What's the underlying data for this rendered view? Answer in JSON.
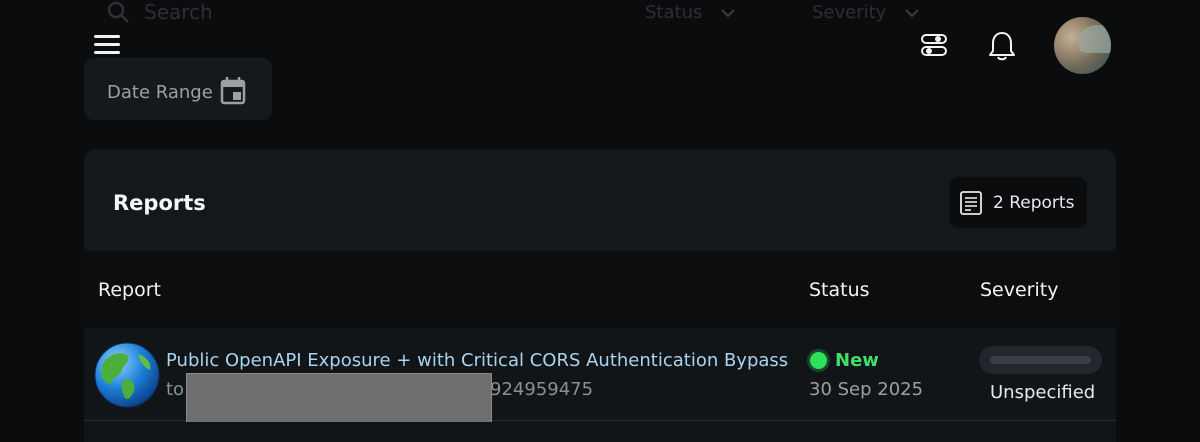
{
  "filters": {
    "search_placeholder": "Search",
    "status_label": "Status",
    "severity_label": "Severity",
    "date_range_label": "Date Range"
  },
  "topbar": {
    "menu_icon": "hamburger-menu-icon",
    "filters_icon": "toggle-filters-icon",
    "notifications_icon": "bell-icon"
  },
  "reports": {
    "title": "Reports",
    "count_label": "2 Reports",
    "columns": [
      "Report",
      "Status",
      "Severity"
    ],
    "rows": [
      {
        "title": "Public OpenAPI Exposure + with Critical CORS Authentication Bypass",
        "sub_prefix": "to",
        "sub_suffix": "924959475",
        "status": "New",
        "date": "30 Sep 2025",
        "severity": "Unspecified",
        "status_color": "#3ee06a"
      }
    ]
  },
  "colors": {
    "background": "#0b0c0e",
    "card": "#111417",
    "link": "#a9d4ef",
    "status_new": "#2fe05b"
  }
}
